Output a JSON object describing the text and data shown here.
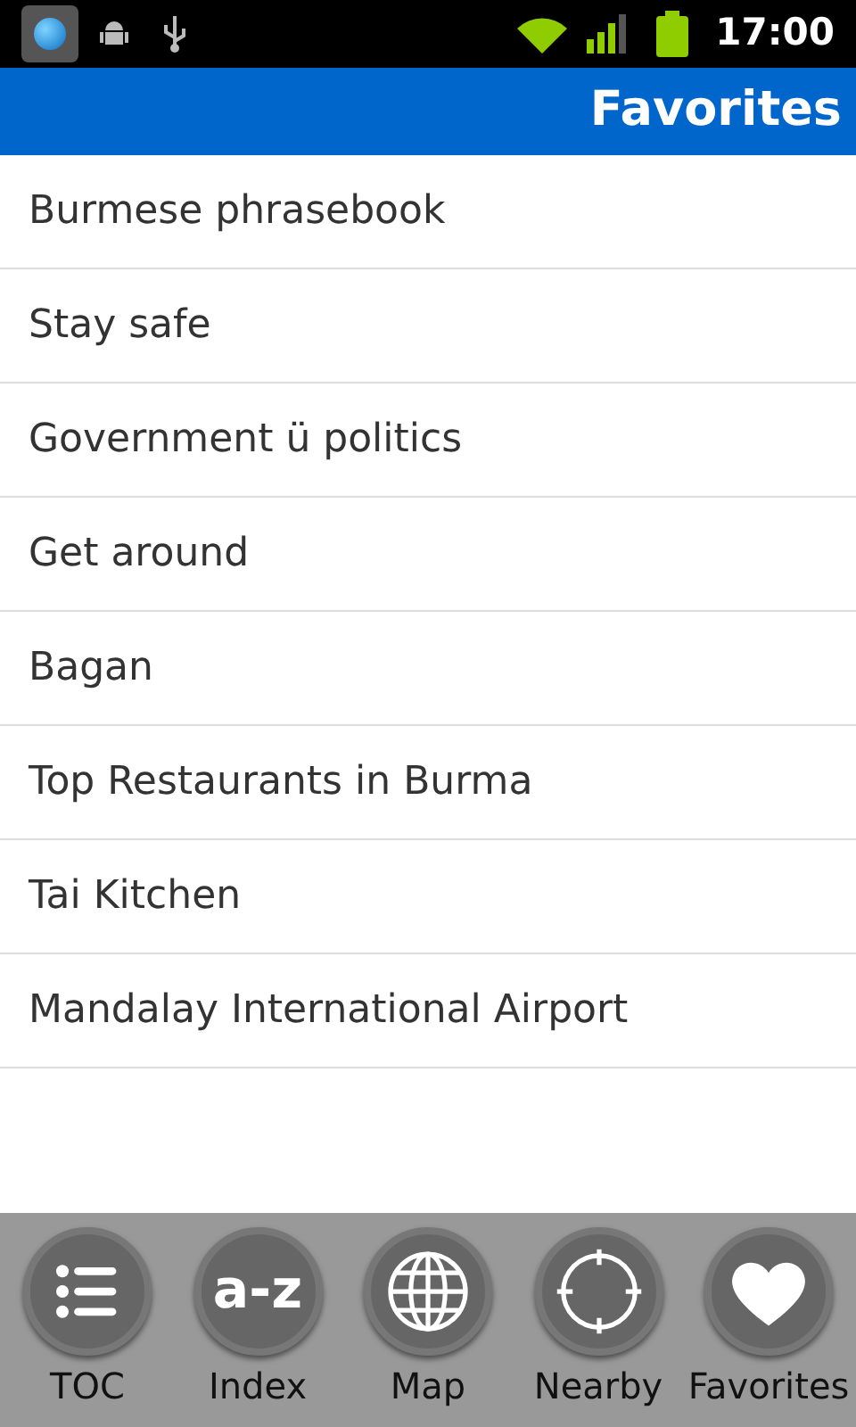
{
  "status_bar": {
    "time": "17:00"
  },
  "header": {
    "title": "Favorites"
  },
  "items": [
    "Burmese phrasebook",
    "Stay safe",
    "Government ü politics",
    "Get around",
    "Bagan",
    "Top Restaurants in Burma",
    "Tai Kitchen",
    "Mandalay International Airport"
  ],
  "toolbar": [
    {
      "kind": "list",
      "label": "TOC"
    },
    {
      "kind": "text",
      "glyph": "a-z",
      "label": "Index"
    },
    {
      "kind": "globe",
      "label": "Map"
    },
    {
      "kind": "crosshair",
      "label": "Nearby"
    },
    {
      "kind": "heart",
      "label": "Favorites"
    }
  ]
}
